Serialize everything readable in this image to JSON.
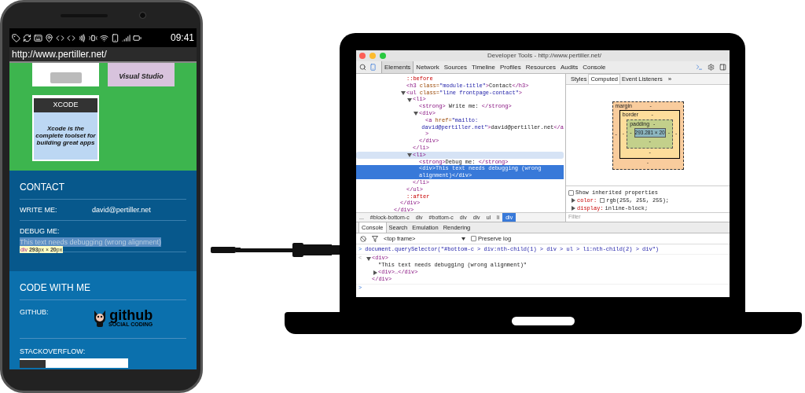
{
  "phone": {
    "status_bar": {
      "time": "09:41"
    },
    "url": "http://www.pertiller.net/",
    "top_tiles": [
      {
        "kind": "image"
      },
      {
        "kind": "text",
        "caption": "Visual Studio"
      }
    ],
    "xcode_tile": {
      "title": "XCODE",
      "caption": "Xcode is the complete toolset for building great apps"
    },
    "contact": {
      "heading": "CONTACT",
      "write_label": "WRITE ME:",
      "write_value": "david@pertiller.net",
      "debug_label": "DEBUG ME:",
      "debug_value": "This text needs debugging (wrong alignment)",
      "highlighted": true,
      "tooltip": {
        "tag": "div",
        "size": "**293**px × **20**px"
      }
    },
    "code": {
      "heading": "CODE WITH ME",
      "github_label": "GITHUB:",
      "github_logo": "github",
      "github_tagline": "SOCIAL CODING",
      "stackoverflow_label": "STACKOVERFLOW:"
    }
  },
  "devtools": {
    "title": "Developer Tools - http://www.pertiller.net/",
    "tabs": [
      {
        "label": "Elements",
        "selected": true
      },
      {
        "label": "Network",
        "selected": false
      },
      {
        "label": "Sources",
        "selected": false
      },
      {
        "label": "Timeline",
        "selected": false
      },
      {
        "label": "Profiles",
        "selected": false
      },
      {
        "label": "Resources",
        "selected": false
      },
      {
        "label": "Audits",
        "selected": false
      },
      {
        "label": "Console",
        "selected": false
      }
    ],
    "dom": [
      {
        "children": [
          {
            "children": [
              {
                "lines": [
                  [
                    {
                      "kind": "pseudo",
                      "text": "::before"
                    }
                  ]
                ],
                "selected": false,
                "hovered": false
              },
              {
                "lines": [
                  [
                    {
                      "kind": "tag",
                      "text": "<h3 "
                    },
                    {
                      "kind": "attr",
                      "text": "class="
                    },
                    {
                      "kind": "value",
                      "text": "\"module-title\""
                    },
                    {
                      "kind": "tag",
                      "text": ">"
                    },
                    {
                      "kind": "text",
                      "text": "Contact"
                    },
                    {
                      "kind": "tag",
                      "text": "</h3>"
                    }
                  ]
                ],
                "selected": false,
                "hovered": false
              },
              {
                "lines": [
                  [
                    {
                      "kind": "tag",
                      "text": "<ul "
                    },
                    {
                      "kind": "attr",
                      "text": "class="
                    },
                    {
                      "kind": "value",
                      "text": "\"line frontpage-contact\""
                    },
                    {
                      "kind": "tag",
                      "text": ">"
                    }
                  ]
                ],
                "selected": false,
                "hovered": false,
                "expanded": true,
                "children": [
                  {
                    "lines": [
                      [
                        {
                          "kind": "tag",
                          "text": "<li>"
                        }
                      ]
                    ],
                    "selected": false,
                    "hovered": false,
                    "expanded": true,
                    "children": [
                      {
                        "lines": [
                          [
                            {
                              "kind": "tag",
                              "text": "<strong>"
                            },
                            {
                              "kind": "text",
                              "text": " Write me: "
                            },
                            {
                              "kind": "tag",
                              "text": "</strong>"
                            }
                          ]
                        ],
                        "selected": false,
                        "hovered": false
                      },
                      {
                        "lines": [
                          [
                            {
                              "kind": "tag",
                              "text": "<div>"
                            }
                          ]
                        ],
                        "selected": false,
                        "hovered": false,
                        "expanded": true,
                        "children": [
                          {
                            "lines": [
                              [
                                {
                                  "kind": "tag",
                                  "text": "<a "
                                },
                                {
                                  "kind": "attr",
                                  "text": "href="
                                },
                                {
                                  "kind": "value",
                                  "text": "\"mailto:"
                                }
                              ],
                              [
                                {
                                  "kind": "value",
                                  "text": "david@pertiller.net\""
                                },
                                {
                                  "kind": "tag",
                                  "text": ">"
                                },
                                {
                                  "kind": "text",
                                  "text": "david@pertiller.net"
                                },
                                {
                                  "kind": "tag",
                                  "text": "</a"
                                }
                              ],
                              [
                                {
                                  "kind": "tag",
                                  "text": ">"
                                }
                              ]
                            ],
                            "selected": false,
                            "hovered": false
                          }
                        ]
                      },
                      {
                        "lines": [
                          [
                            {
                              "kind": "tag",
                              "text": "</div>"
                            }
                          ]
                        ],
                        "selected": false,
                        "hovered": false
                      }
                    ]
                  },
                  {
                    "lines": [
                      [
                        {
                          "kind": "tag",
                          "text": "</li>"
                        }
                      ]
                    ],
                    "selected": false,
                    "hovered": false
                  },
                  {
                    "lines": [
                      [
                        {
                          "kind": "tag",
                          "text": "<li>"
                        }
                      ]
                    ],
                    "selected": false,
                    "hovered": true,
                    "expanded": true,
                    "children": [
                      {
                        "lines": [
                          [
                            {
                              "kind": "tag",
                              "text": "<strong>"
                            },
                            {
                              "kind": "text",
                              "text": "Debug me: "
                            },
                            {
                              "kind": "tag",
                              "text": "</strong>"
                            }
                          ]
                        ],
                        "selected": false,
                        "hovered": false
                      },
                      {
                        "lines": [
                          [
                            {
                              "kind": "tag",
                              "text": "<div>"
                            },
                            {
                              "kind": "text",
                              "text": "This text needs debugging (wrong"
                            }
                          ],
                          [
                            {
                              "kind": "text",
                              "text": "alignment)"
                            },
                            {
                              "kind": "tag",
                              "text": "</div>"
                            }
                          ]
                        ],
                        "selected": true,
                        "hovered": false
                      }
                    ]
                  },
                  {
                    "lines": [
                      [
                        {
                          "kind": "tag",
                          "text": "</li>"
                        }
                      ]
                    ],
                    "selected": false,
                    "hovered": false
                  }
                ]
              },
              {
                "lines": [
                  [
                    {
                      "kind": "tag",
                      "text": "</ul>"
                    }
                  ]
                ],
                "selected": false,
                "hovered": false
              },
              {
                "lines": [
                  [
                    {
                      "kind": "pseudo",
                      "text": "::after"
                    }
                  ]
                ],
                "selected": false,
                "hovered": false
              }
            ]
          },
          {
            "lines": [
              [
                {
                  "kind": "tag",
                  "text": "</div>"
                }
              ]
            ],
            "selected": false,
            "hovered": false
          }
        ]
      },
      {
        "lines": [
          [
            {
              "kind": "tag",
              "text": "</div>"
            }
          ]
        ],
        "selected": false,
        "hovered": false
      }
    ],
    "breadcrumbs": [
      {
        "label": "...",
        "selected": false
      },
      {
        "label": "#block-bottom-c",
        "selected": false
      },
      {
        "label": "div",
        "selected": false
      },
      {
        "label": "#bottom-c",
        "selected": false
      },
      {
        "label": "div",
        "selected": false
      },
      {
        "label": "div",
        "selected": false
      },
      {
        "label": "ul",
        "selected": false
      },
      {
        "label": "li",
        "selected": false
      },
      {
        "label": "div",
        "selected": true
      }
    ],
    "side_tabs": [
      {
        "label": "Styles",
        "selected": false
      },
      {
        "label": "Computed",
        "selected": true
      },
      {
        "label": "Event Listeners",
        "selected": false
      }
    ],
    "side_more": "»",
    "box_model": {
      "margin": {
        "label": "margin",
        "top": "-",
        "right": "-",
        "bottom": "-",
        "left": "-"
      },
      "border": {
        "label": "border",
        "top": "-",
        "right": "-",
        "bottom": "-",
        "left": "-"
      },
      "padding": {
        "label": "padding",
        "top": "-",
        "right": "-",
        "bottom": "-",
        "left": "-"
      },
      "content": "293.281 × 20"
    },
    "show_inherited": {
      "label": "Show inherited properties",
      "checked": false
    },
    "properties": [
      {
        "name": "color:",
        "value": "rgb(255, 255, 255);",
        "color": "#ffffff"
      },
      {
        "name": "display:",
        "value": "inline-block;"
      }
    ],
    "filter_placeholder": "Filter",
    "drawer_tabs": [
      {
        "label": "Console",
        "selected": true
      },
      {
        "label": "Search",
        "selected": false
      },
      {
        "label": "Emulation",
        "selected": false
      },
      {
        "label": "Rendering",
        "selected": false
      }
    ],
    "frame_select": "<top frame>",
    "preserve_log": {
      "label": "Preserve log",
      "checked": false
    },
    "console": [
      {
        "kind": "input",
        "prompt": ">",
        "text": "document.querySelector(\"#bottom-c > div:nth-child(1) > div > ul > li:nth-child(2) > div\")"
      },
      {
        "kind": "output",
        "prompt": "<",
        "tree": [
          {
            "lines": [
              [
                {
                  "kind": "tag",
                  "text": "<div>"
                }
              ]
            ],
            "selected": false,
            "hovered": false,
            "expanded": true,
            "children": [
              {
                "lines": [
                  [
                    {
                      "kind": "text",
                      "text": "\"This text needs debugging (wrong alignment)\""
                    }
                  ]
                ],
                "selected": false,
                "hovered": false
              },
              {
                "lines": [
                  [
                    {
                      "kind": "tag",
                      "text": "<div>…</div>"
                    }
                  ]
                ],
                "selected": false,
                "hovered": false,
                "expanded": false
              }
            ]
          },
          {
            "lines": [
              [
                {
                  "kind": "tag",
                  "text": "</div>"
                }
              ]
            ],
            "selected": false,
            "hovered": false
          }
        ]
      },
      {
        "kind": "prompt",
        "prompt": ">"
      }
    ]
  }
}
